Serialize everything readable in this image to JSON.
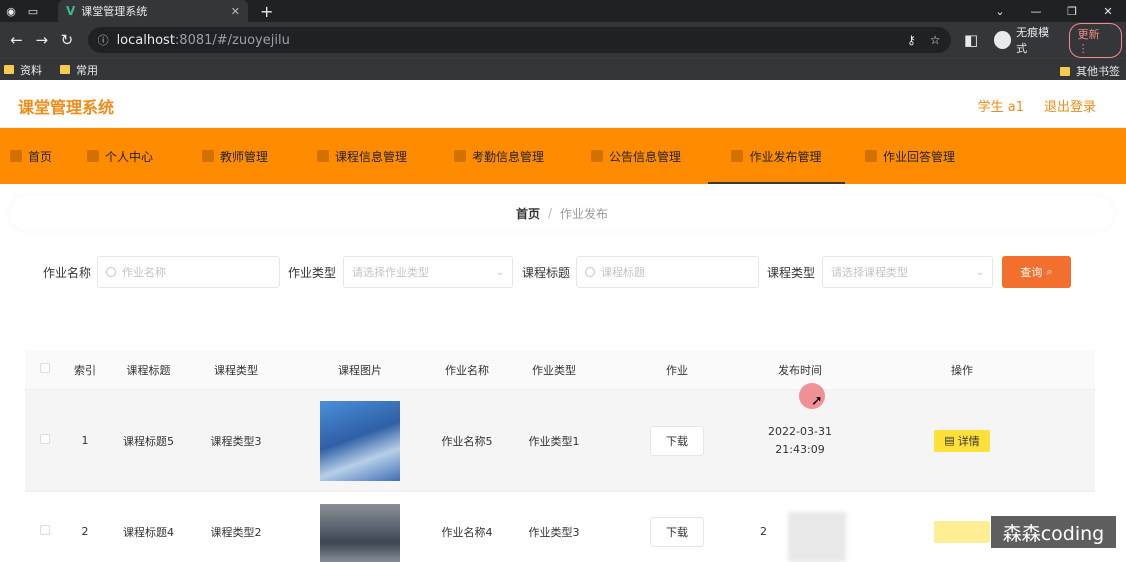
{
  "browser": {
    "tab_title": "课堂管理系统",
    "url_host": "localhost",
    "url_rest": ":8081/#/zuoyejilu",
    "profile_label": "无痕模式",
    "update_label": "更新",
    "bookmarks": [
      "资料",
      "常用"
    ],
    "other_bookmarks": "其他书签"
  },
  "header": {
    "title": "课堂管理系统",
    "user": "学生 a1",
    "logout": "退出登录"
  },
  "nav": {
    "items": [
      {
        "label": "首页"
      },
      {
        "label": "个人中心"
      },
      {
        "label": "教师管理"
      },
      {
        "label": "课程信息管理"
      },
      {
        "label": "考勤信息管理"
      },
      {
        "label": "公告信息管理"
      },
      {
        "label": "作业发布管理"
      },
      {
        "label": "作业回答管理"
      }
    ],
    "active_index": 6
  },
  "breadcrumb": {
    "home": "首页",
    "separator": "/",
    "current": "作业发布"
  },
  "search": {
    "field1_label": "作业名称",
    "field1_placeholder": "作业名称",
    "field2_label": "作业类型",
    "field2_placeholder": "请选择作业类型",
    "field3_label": "课程标题",
    "field3_placeholder": "课程标题",
    "field4_label": "课程类型",
    "field4_placeholder": "请选择课程类型",
    "button_label": "查询"
  },
  "table": {
    "columns": [
      "索引",
      "课程标题",
      "课程类型",
      "课程图片",
      "作业名称",
      "作业类型",
      "作业",
      "发布时间",
      "操作"
    ],
    "rows": [
      {
        "index": "1",
        "course_title": "课程标题5",
        "course_type": "课程类型3",
        "hw_name": "作业名称5",
        "hw_type": "作业类型1",
        "download": "下载",
        "date": "2022-03-31",
        "time": "21:43:09",
        "action": "详情"
      },
      {
        "index": "2",
        "course_title": "课程标题4",
        "course_type": "课程类型2",
        "hw_name": "作业名称4",
        "hw_type": "作业类型3",
        "download": "下载",
        "date": "2",
        "time": "",
        "action": ""
      }
    ]
  },
  "watermark": "森森coding"
}
